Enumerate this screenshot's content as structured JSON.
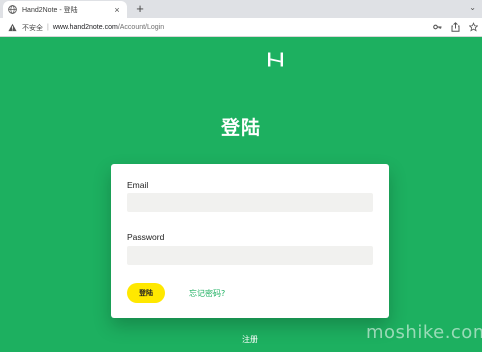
{
  "browser": {
    "tab": {
      "title": "Hand2Note - 登陆",
      "close_glyph": "×"
    },
    "new_tab_glyph": "+",
    "tab_menu_glyph": "⌄",
    "address": {
      "security_label": "不安全",
      "separator": "|",
      "host": "www.hand2note.com",
      "path": "/Account/Login"
    },
    "toolbar_icons": [
      "key-icon",
      "share-icon",
      "star-icon"
    ]
  },
  "page": {
    "logo_icon": "hand2note-logo-icon",
    "title": "登陆",
    "form": {
      "email_label": "Email",
      "email_value": "",
      "password_label": "Password",
      "password_value": "",
      "login_button": "登陆",
      "forgot_link": "忘记密码?"
    },
    "register_link": "注册"
  },
  "watermark": "moshike.com",
  "colors": {
    "background": "#1db060",
    "button": "#ffe800",
    "link": "#1db060",
    "input_bg": "#f1f1ef"
  }
}
